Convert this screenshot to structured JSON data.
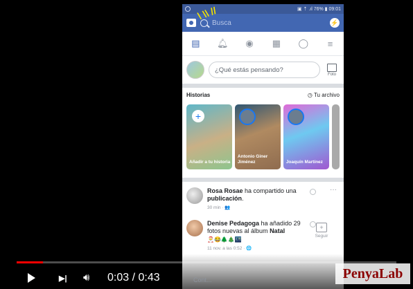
{
  "phone": {
    "status": {
      "right": "▣ ⇡ .ıl 76% ▮ 09:01"
    },
    "search": {
      "placeholder": "Busca"
    },
    "composer": {
      "placeholder": "¿Qué estás pensando?",
      "photo_label": "Foto"
    },
    "stories": {
      "title": "Historias",
      "archive": "Tu archivo",
      "items": [
        {
          "label": "Añadir a tu historia"
        },
        {
          "label": "Antonio Giner Jiménez"
        },
        {
          "label": "Joaquín Martínez"
        }
      ]
    },
    "posts": [
      {
        "name": "Rosa Rosae",
        "text": " ha compartido una ",
        "bold": "publicación",
        "tail": ".",
        "meta": "30 min · 👥"
      },
      {
        "name": "Denise Pedagoga",
        "text": " ha añadido 29 fotos nuevas al álbum ",
        "bold": "Natal",
        "tail": "",
        "emojis": "🎅😂🌲🎄🌃",
        "meta": "11 nov. a las 0:52 · 🌐",
        "follow": "Seguir"
      }
    ],
    "cont": "Cont..."
  },
  "player": {
    "progress": 0.07,
    "time": "0:03 / 0:43",
    "accent": "#ff0000"
  },
  "watermark": "PenyaLab"
}
